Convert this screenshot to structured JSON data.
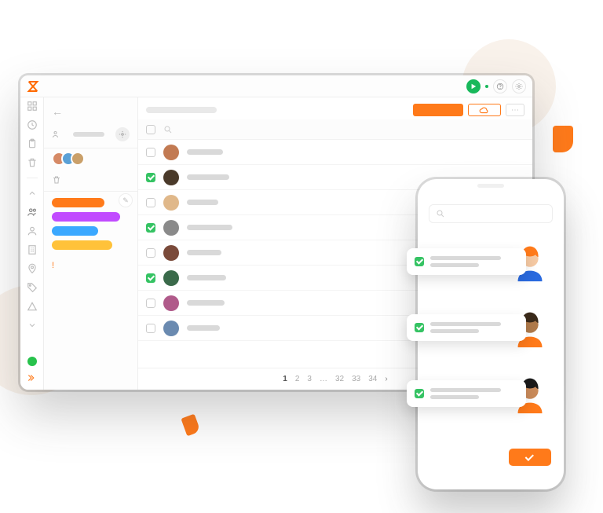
{
  "colors": {
    "accent": "#ff7a1a",
    "success": "#35c363",
    "play": "#18b85b"
  },
  "rail_icons": [
    "grid-icon",
    "clock-icon",
    "clipboard-icon",
    "trash-icon",
    "chevron-up-icon",
    "users-icon",
    "user-icon",
    "building-icon",
    "location-icon",
    "tag-icon",
    "triangle-icon",
    "chevron-down-icon"
  ],
  "topbar": {
    "play_label": "start-timer",
    "help_label": "help",
    "settings_label": "settings"
  },
  "panel": {
    "back_label": "back",
    "filter_label": "members",
    "avatars": [
      "#d68a66",
      "#5aa0d6",
      "#caa06a"
    ],
    "tags": [
      {
        "color": "#ff7a1a",
        "w": "68%"
      },
      {
        "color": "#c14bff",
        "w": "88%"
      },
      {
        "color": "#3aa8ff",
        "w": "60%"
      },
      {
        "color": "#ffc23a",
        "w": "78%"
      }
    ]
  },
  "toolbar": {
    "primary_label": "",
    "cloud_label": "export",
    "more_label": "more"
  },
  "rows": [
    {
      "checked": false,
      "avatar": "#c27a52",
      "name_w": 46
    },
    {
      "checked": true,
      "avatar": "#4a3a2a",
      "name_w": 54
    },
    {
      "checked": false,
      "avatar": "#e0b88a",
      "name_w": 40
    },
    {
      "checked": true,
      "avatar": "#8a8a8a",
      "name_w": 58
    },
    {
      "checked": false,
      "avatar": "#7a4a3a",
      "name_w": 44
    },
    {
      "checked": true,
      "avatar": "#3a6a4a",
      "name_w": 50
    },
    {
      "checked": false,
      "avatar": "#b05a8a",
      "name_w": 48
    },
    {
      "checked": false,
      "avatar": "#6a8ab0",
      "name_w": 42
    }
  ],
  "pagination": {
    "pages": [
      "1",
      "2",
      "3",
      "…",
      "32",
      "33",
      "34"
    ],
    "current": "1"
  },
  "phone": {
    "search_placeholder": "",
    "contacts": [
      {
        "hair": "#ff7a1a",
        "skin": "#f5c9a3",
        "shirt": "#2a6adf"
      },
      {
        "hair": "#3a2a1a",
        "skin": "#b07a4a",
        "shirt": "#ff7a1a"
      },
      {
        "hair": "#1a1a1a",
        "skin": "#c98a5a",
        "shirt": "#ff7a1a"
      }
    ]
  }
}
